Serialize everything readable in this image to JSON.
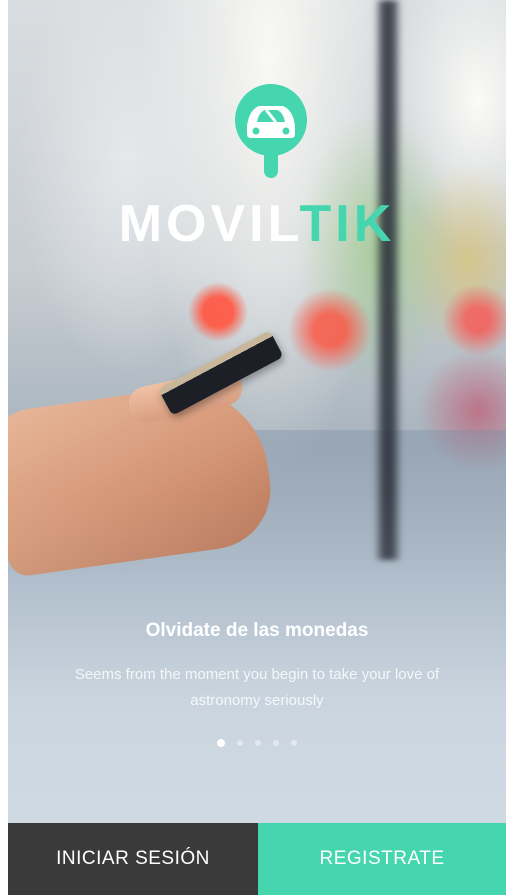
{
  "brand": {
    "part1": "MOVIL",
    "part2": "TIK",
    "accent_color": "#45d6b0"
  },
  "slide": {
    "headline": "Olvidate de las monedas",
    "subtext": "Seems from the moment you begin to take your love of astronomy seriously",
    "total": 5,
    "active_index": 0
  },
  "buttons": {
    "login_label": "INICIAR SESIÓN",
    "login_color": "#3a3a3a",
    "register_label": "REGISTRATE",
    "register_color": "#45d6b0"
  },
  "icons": {
    "logo": "car-location-pin-icon"
  }
}
